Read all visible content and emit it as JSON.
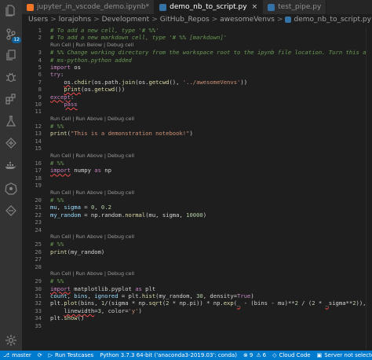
{
  "tabs": [
    {
      "label": "jupyter_in_vscode_demo.ipynb*",
      "active": false,
      "icon_color": "#f37626"
    },
    {
      "label": "demo_nb_to_script.py",
      "active": true,
      "icon_color": "#3572a5"
    },
    {
      "label": "test_pipe.py",
      "active": false,
      "icon_color": "#3572a5"
    }
  ],
  "tab_close_glyph": "×",
  "breadcrumb": [
    "Users",
    "lorajohns",
    "Development",
    "GitHub_Repos",
    "awesomeVenvs",
    "demo_nb_to_script.py"
  ],
  "breadcrumb_sep": ">",
  "activity_badge": "12",
  "code_lines": [
    {
      "ln": "1",
      "html": "<span class=\"cmt\"># To add a new cell, type '# %%'</span>"
    },
    {
      "ln": "2",
      "html": "<span class=\"cmt\"># To add a new markdown cell, type '# %% [markdown]'</span>"
    },
    {
      "lens": "Run Cell | Run Below | Debug cell"
    },
    {
      "ln": "3",
      "html": "<span class=\"cmt\"># %% Change working directory from the workspace root to the ipynb file location. Turn this addition</span>"
    },
    {
      "ln": "4",
      "html": "<span class=\"cmt\"># ms-python.python added</span>"
    },
    {
      "ln": "5",
      "html": "<span class=\"kw\">import</span> os"
    },
    {
      "ln": "6",
      "html": "<span class=\"kw\">try</span>:"
    },
    {
      "ln": "7",
      "html": "    <span class=\"squig\">os</span>.<span class=\"fn\">chdir</span>(os.path.<span class=\"fn\">join</span>(os.<span class=\"fn\">getcwd</span>(), <span class=\"str\">'../awesomeVenvs'</span>))"
    },
    {
      "ln": "8",
      "html": "    <span class=\"fn squig\">print</span>(os.<span class=\"fn\">getcwd</span>())"
    },
    {
      "ln": "9",
      "html": "<span class=\"kw squig\">except</span>:"
    },
    {
      "ln": "10",
      "html": "    <span class=\"kw squig\">pass</span>"
    },
    {
      "ln": "11",
      "html": ""
    },
    {
      "lens": "Run Cell | Run Above | Debug cell"
    },
    {
      "ln": "12",
      "html": "<span class=\"cmt\"># %%</span>"
    },
    {
      "ln": "13",
      "html": "<span class=\"fn\">print</span>(<span class=\"str\">\"This is a demonstration notebook!\"</span>)"
    },
    {
      "ln": "14",
      "html": ""
    },
    {
      "ln": "15",
      "html": ""
    },
    {
      "lens": "Run Cell | Run Above | Debug cell"
    },
    {
      "ln": "16",
      "html": "<span class=\"cmt\"># %%</span>"
    },
    {
      "ln": "17",
      "html": "<span class=\"kw squig\">import</span> numpy <span class=\"kw\">as</span> np"
    },
    {
      "ln": "18",
      "html": ""
    },
    {
      "ln": "19",
      "html": ""
    },
    {
      "lens": "Run Cell | Run Above | Debug cell"
    },
    {
      "ln": "20",
      "html": "<span class=\"cmt\"># %%</span>"
    },
    {
      "ln": "21",
      "html": "<span class=\"var\">mu</span>, <span class=\"var\">sigma</span> = <span class=\"num\">0</span>, <span class=\"num\">0.2</span>"
    },
    {
      "ln": "22",
      "html": "<span class=\"var\">my_random</span> = np.random.<span class=\"fn\">normal</span>(mu, sigma, <span class=\"num\">10000</span>)"
    },
    {
      "ln": "23",
      "html": ""
    },
    {
      "ln": "24",
      "html": ""
    },
    {
      "lens": "Run Cell | Run Above | Debug cell"
    },
    {
      "ln": "25",
      "html": "<span class=\"cmt\"># %%</span>"
    },
    {
      "ln": "26",
      "html": "<span class=\"fn\">print</span>(my_random)"
    },
    {
      "ln": "27",
      "html": ""
    },
    {
      "ln": "28",
      "html": ""
    },
    {
      "lens": "Run Cell | Run Above | Debug cell"
    },
    {
      "ln": "29",
      "html": "<span class=\"cmt\"># %%</span>"
    },
    {
      "ln": "30",
      "html": "<span class=\"kw squig\">import</span> matplotlib.pyplot <span class=\"kw\">as</span> plt"
    },
    {
      "ln": "31",
      "html": "<span class=\"var\">count</span>, <span class=\"var\">bins</span>, <span class=\"var\">ignored</span> = plt.<span class=\"fn\">hist</span>(my_random, <span class=\"num\">30</span>, density=<span class=\"kw\">True</span>)"
    },
    {
      "ln": "32",
      "html": "plt.<span class=\"fn\">plot</span>(bins, <span class=\"num\">1</span>/(sigma * np.<span class=\"fn\">sqrt</span>(<span class=\"num\">2</span> * np.pi)) * np.<span class=\"fn\">exp</span>(<span class=\"squig\">_</span> - (bins - mu)**<span class=\"num\">2</span> / (<span class=\"num\">2</span> * <span class=\"squig\">_</span>sigma**<span class=\"num\">2</span>)),"
    },
    {
      "ln": "33",
      "html": "    <span class=\"squig\">linewidth</span>=<span class=\"num\">3</span>, color=<span class=\"str\">'y'</span>)"
    },
    {
      "ln": "34",
      "html": "plt.<span class=\"fn\">show</span>()"
    },
    {
      "ln": "35",
      "html": ""
    }
  ],
  "status": {
    "branch": "master",
    "run_testcases": "Run Testcases",
    "python": "Python 3.7.3 64-bit ('anaconda3-2019.03': conda)",
    "errors": "9",
    "warnings": "6",
    "cloud": "Cloud Code",
    "server": "Server not selected"
  },
  "colors": {
    "status_bar": "#007acc",
    "activity_bar": "#333333",
    "editor_bg": "#1e1e1e",
    "comment": "#6a9955",
    "keyword": "#c586c0"
  }
}
